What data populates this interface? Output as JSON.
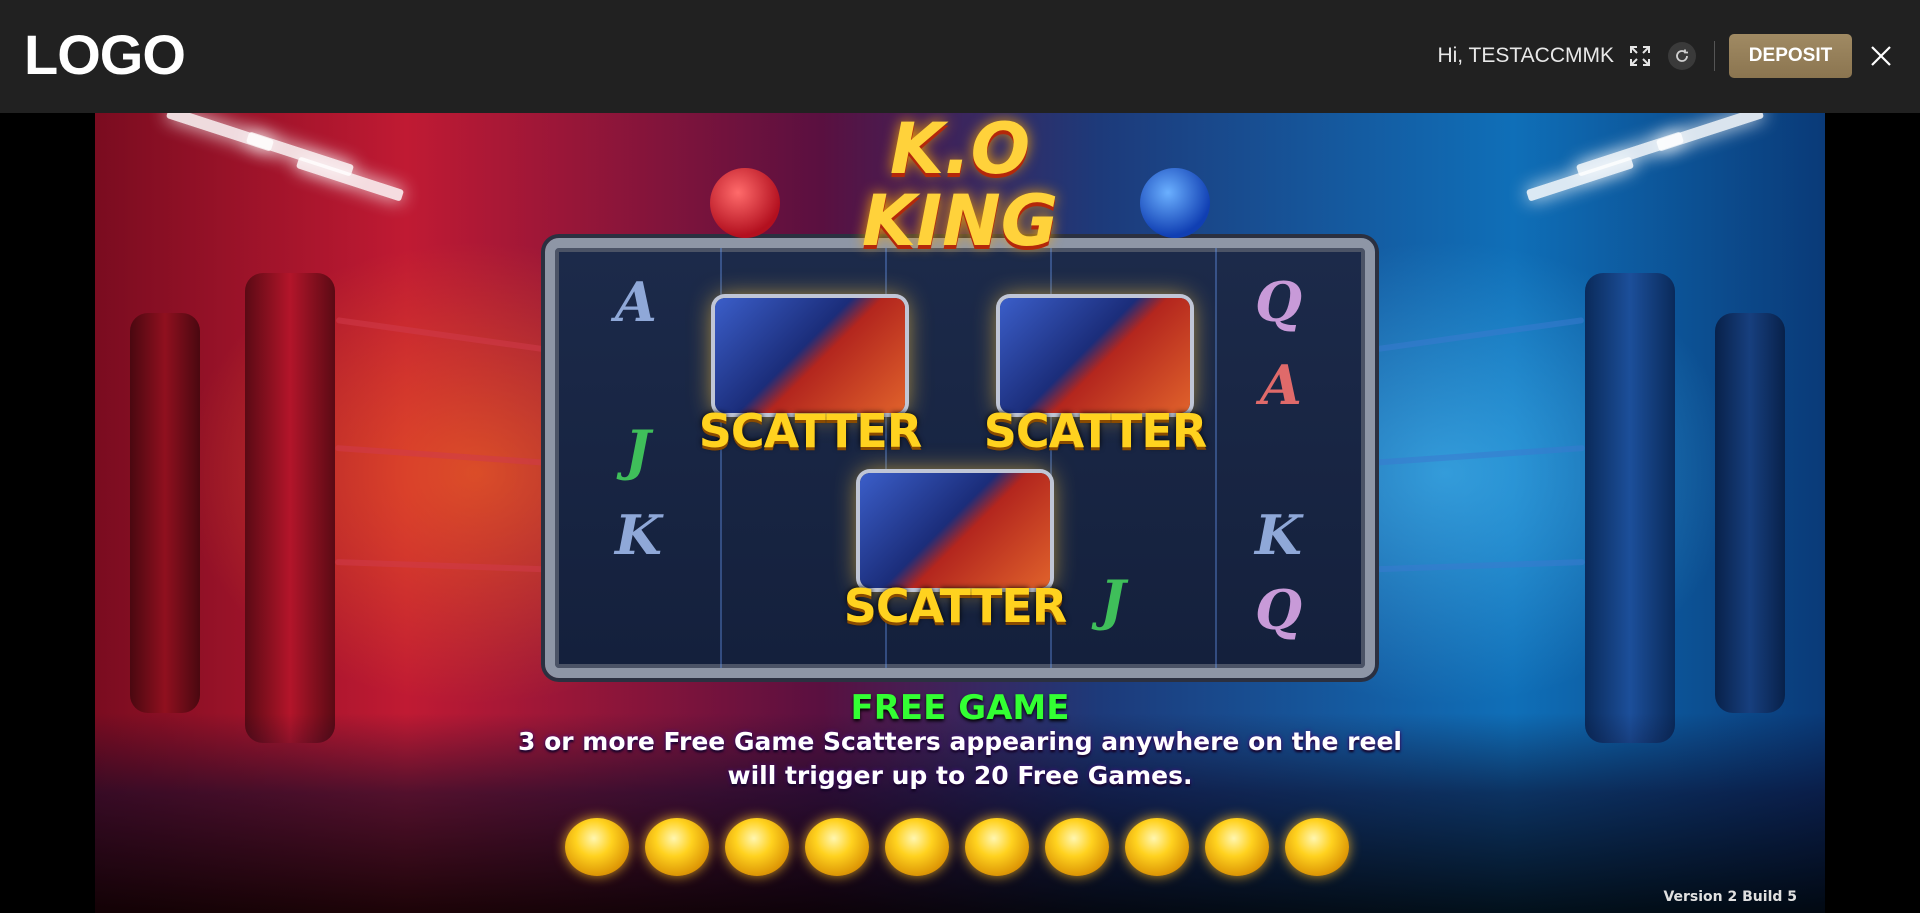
{
  "header": {
    "logo_text": "LOGO",
    "greeting": "Hi, TESTACCMMK",
    "fullscreen_icon": "expand-icon",
    "refresh_icon": "refresh-icon",
    "deposit_label": "DEPOSIT",
    "close_icon": "close-icon",
    "colors": {
      "background": "#212121",
      "deposit": "#8f7854",
      "text": "#ffffff"
    }
  },
  "game": {
    "logo": "K.O KING",
    "logo_line1": "K.O",
    "logo_line2": "KING",
    "reel_symbols": {
      "col1": [
        "A",
        "J",
        "K"
      ],
      "col5": [
        "Q",
        "A",
        "K",
        "Q"
      ],
      "col4": [
        "J"
      ]
    },
    "scatter_label": "SCATTER",
    "feature_title": "FREE GAME",
    "feature_line1": "3 or more Free Game Scatters appearing anywhere on the reel",
    "feature_line2": "will trigger up to 20 Free Games.",
    "coin_count": 10,
    "version": "Version 2 Build 5",
    "colors": {
      "feature_title": "#33ff33",
      "scatter": "#ffd21f"
    }
  }
}
